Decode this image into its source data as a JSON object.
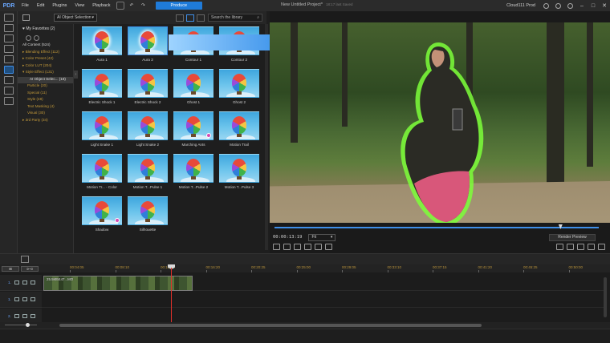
{
  "menubar": {
    "logo": "PDR",
    "menus": [
      "File",
      "Edit",
      "Plugins",
      "View",
      "Playback"
    ],
    "produce_label": "Produce",
    "project_title": "New Untitled Project*",
    "project_saved": "18:17 last Saved",
    "user": "Cloud111 Prod"
  },
  "library": {
    "filter_label": "AI Object Selection",
    "search_placeholder": "Search the library",
    "favorites_label": "My Favorites (2)",
    "tree": [
      {
        "label": "All Content (524)",
        "style": "plain"
      },
      {
        "label": "▸ Blending Effect (112)",
        "style": "cat"
      },
      {
        "label": "▸ Color Preset (42)",
        "style": "cat"
      },
      {
        "label": "▸ Color LUT (204)",
        "style": "cat"
      },
      {
        "label": "▾ Style Effect (131)",
        "style": "cat"
      },
      {
        "label": "AI Object Selec... (18)",
        "style": "sel"
      },
      {
        "label": "Particle (20)",
        "style": "cat"
      },
      {
        "label": "Special (11)",
        "style": "cat"
      },
      {
        "label": "Style (48)",
        "style": "cat"
      },
      {
        "label": "Text Masking (4)",
        "style": "cat"
      },
      {
        "label": "Visual (30)",
        "style": "cat"
      },
      {
        "label": "▸ 3rd Party (34)",
        "style": "cat"
      }
    ],
    "tiles": [
      {
        "label": "Aura 1"
      },
      {
        "label": "Aura 2"
      },
      {
        "label": "Contour 1"
      },
      {
        "label": "Contour 2"
      },
      {
        "label": "Electric Shock 1"
      },
      {
        "label": "Electric Shock 2"
      },
      {
        "label": "Ghost 1"
      },
      {
        "label": "Ghost 2"
      },
      {
        "label": "Light Snake 1"
      },
      {
        "label": "Light Snake 2"
      },
      {
        "label": "Marching Ants"
      },
      {
        "label": "Motion Trail"
      },
      {
        "label": "Motion Tr... - Color"
      },
      {
        "label": "Motion T...Pulse 1"
      },
      {
        "label": "Motion T...Pulse 2"
      },
      {
        "label": "Motion T...Pulse 3"
      },
      {
        "label": "Shadow"
      },
      {
        "label": "Silhouette"
      }
    ]
  },
  "preview": {
    "timecode": "00:00:13:19",
    "fit_label": "Fit",
    "render_label": "Render Preview",
    "playback_position": 0.882
  },
  "timeline": {
    "zoom_labels": [
      "⊞",
      "⊳⊲"
    ],
    "ruler_ticks": [
      "00:04:05",
      "00:08:10",
      "00:12:15",
      "00:16:20",
      "00:20:25",
      "00:25:00",
      "00:29:05",
      "00:33:10",
      "00:37:15",
      "00:41:20",
      "00:45:25",
      "00:50:00"
    ],
    "tracks": [
      "1.",
      "1.",
      "2."
    ],
    "clip_label": "25.5MB447...MO"
  },
  "colors": {
    "accent": "#1f7bd9",
    "category": "#c49a3a",
    "playhead": "#e0302a",
    "glow": "#7dff3a"
  }
}
